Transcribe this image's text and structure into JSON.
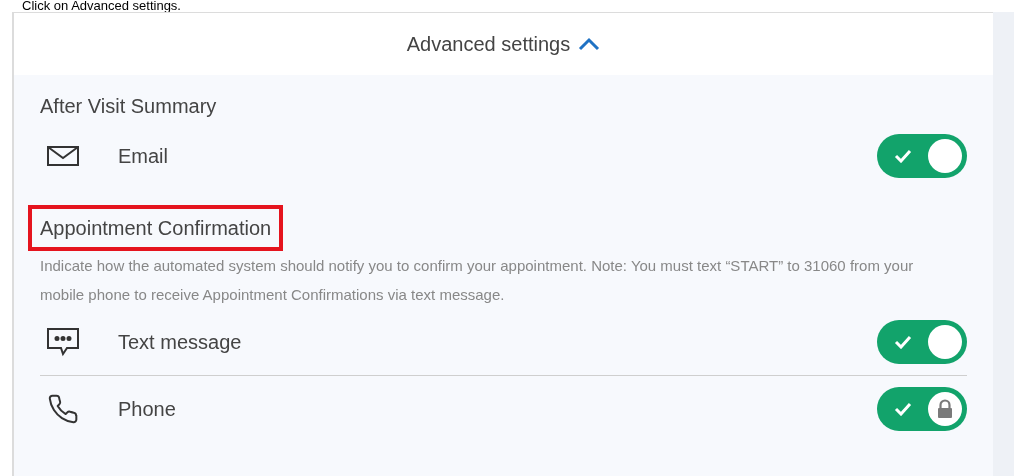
{
  "instruction": "Click on Advanced settings.",
  "header": {
    "title": "Advanced settings",
    "expanded": true
  },
  "sections": [
    {
      "title": "After Visit Summary",
      "highlighted": false,
      "options": [
        {
          "label": "Email",
          "kind": "mail",
          "on": true,
          "locked": false
        }
      ]
    },
    {
      "title": "Appointment Confirmation",
      "highlighted": true,
      "description": "Indicate how the automated system should notify you to confirm your appointment. Note: You must text “START” to 31060 from your mobile phone to receive Appointment Confirmations via text message.",
      "options": [
        {
          "label": "Text message",
          "kind": "chat",
          "on": true,
          "locked": false
        },
        {
          "label": "Phone",
          "kind": "phone",
          "on": true,
          "locked": true
        }
      ]
    }
  ]
}
